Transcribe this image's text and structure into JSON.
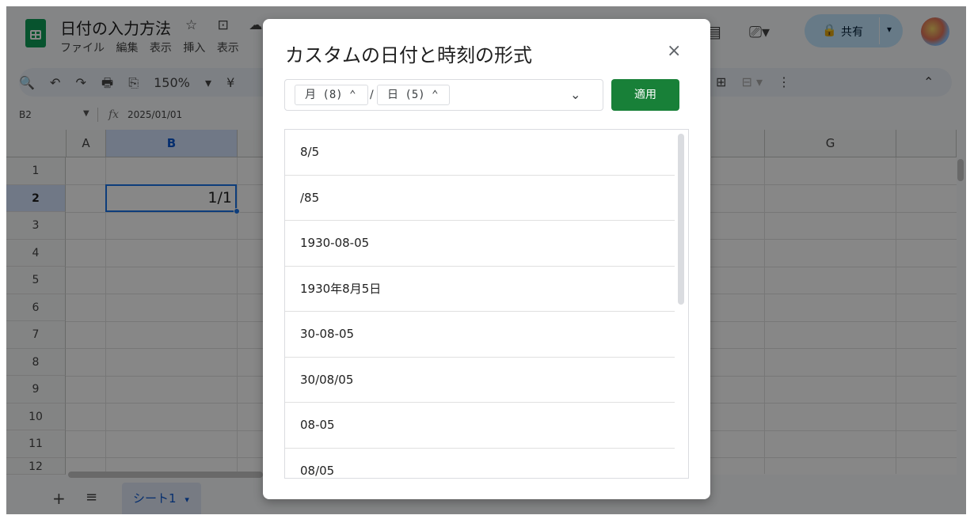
{
  "doc": {
    "title": "日付の入力方法",
    "title_icons": "☆ ⊡ ☁",
    "menu": [
      "ファイル",
      "編集",
      "表示",
      "挿入",
      "表示"
    ]
  },
  "toolbar": {
    "items": [
      "🔍",
      "↶",
      "↷",
      "🖶",
      "⎘",
      "150%",
      "▾",
      "¥"
    ],
    "right_items": [
      "⊞",
      "⊟",
      "▾",
      "⋮",
      "⌃"
    ]
  },
  "formula_bar": {
    "cell_ref": "B2",
    "fx_symbol": "fx",
    "value": "2025/01/01"
  },
  "header_right": {
    "comment_icon": "▤",
    "meet_icon": "⎚▾",
    "share_label": "共有",
    "share_lock": "🔒",
    "share_arrow": "▾"
  },
  "grid": {
    "columns": [
      "A",
      "B",
      "G"
    ],
    "rows": [
      "1",
      "2",
      "3",
      "4",
      "5",
      "6",
      "7",
      "8",
      "9",
      "10",
      "11",
      "12"
    ],
    "selected_cell_value": "1/1"
  },
  "bottom": {
    "add_icon": "+",
    "list_icon": "≡",
    "sheet_name": "シート1",
    "sheet_arrow": "▾"
  },
  "dialog": {
    "title": "カスタムの日付と時刻の形式",
    "close": "×",
    "chip1": "月 (8) ⌃",
    "chip2": "日 (5) ⌃",
    "separator": "/",
    "dropdown": "⌄",
    "apply_label": "適用",
    "formats": [
      "8/5",
      "/85",
      "1930-08-05",
      "1930年8月5日",
      "30-08-05",
      "30/08/05",
      "08-05",
      "08/05"
    ]
  }
}
